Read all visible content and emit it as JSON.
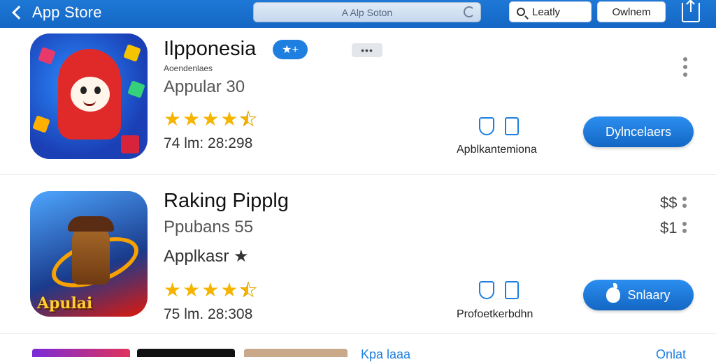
{
  "topbar": {
    "back_label": "App Store",
    "search_placeholder": "A Alp Soton",
    "lookup_label": "Leatly",
    "outline_label": "Owlnem"
  },
  "apps": [
    {
      "title": "Ilpponesia",
      "badge": "★+",
      "subtitle": "Aoendenlaes",
      "category": "Appular 30",
      "rating_stars": 4.5,
      "downloads": "74 lm: 28:298",
      "caption": "Apblkantemiona",
      "cta_label": "Dylncelaers"
    },
    {
      "title": "Raking Pipplg",
      "subtitle": "Ppubans 55",
      "category": "Applkasr ★",
      "rating_stars": 4.5,
      "downloads": "75 lm. 28:308",
      "caption": "Profoetkerbdhn",
      "cta_label": "Snlaary",
      "prices": [
        "$$",
        "$1"
      ],
      "icon_word": "Apulai"
    }
  ],
  "bottom": {
    "link_left": "Kpa laaa",
    "link_right": "Onlat"
  },
  "colors": {
    "accent": "#1f7fe0",
    "star": "#f5b400",
    "topbar": "#1467c4"
  }
}
